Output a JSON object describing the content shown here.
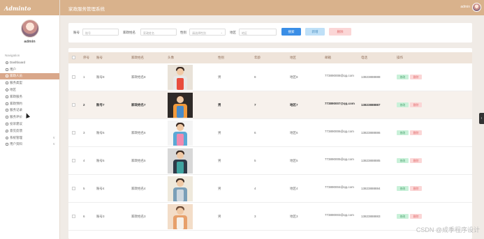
{
  "app": {
    "brand": "Adminto",
    "title": "家政服务管理系统",
    "user": "admin"
  },
  "sidebar": {
    "username": "admin",
    "section_label": "Navigation",
    "items": [
      {
        "label": "Dashboard",
        "icon": "home-icon"
      },
      {
        "label": "用户",
        "icon": "grid-icon"
      },
      {
        "label": "家政人员",
        "icon": "grid-icon",
        "active": true
      },
      {
        "label": "服务类型",
        "icon": "grid-icon"
      },
      {
        "label": "地区",
        "icon": "tag-icon"
      },
      {
        "label": "家政服务",
        "icon": "grid-icon"
      },
      {
        "label": "家政预约",
        "icon": "grid-icon"
      },
      {
        "label": "服务记录",
        "icon": "grid-icon"
      },
      {
        "label": "服务评价",
        "icon": "grid-icon"
      },
      {
        "label": "投诉建议",
        "icon": "grid-icon"
      },
      {
        "label": "意见反馈",
        "icon": "pin-icon"
      },
      {
        "label": "系统管理",
        "icon": "gear-icon",
        "chevron": "∨"
      },
      {
        "label": "用户资料",
        "icon": "user-icon",
        "chevron": "∨"
      }
    ]
  },
  "search": {
    "account_label": "账号",
    "account_placeholder": "账号",
    "name_label": "家政姓名",
    "name_placeholder": "家政姓名",
    "gender_label": "性别",
    "gender_placeholder": "请选择性别",
    "region_label": "地区",
    "region_placeholder": "地区",
    "search_btn": "搜索",
    "add_btn": "新增",
    "delete_btn": "删除"
  },
  "table": {
    "headers": [
      "序号",
      "账号",
      "家政姓名",
      "头像",
      "性别",
      "年龄",
      "地区",
      "邮箱",
      "电话",
      "操作"
    ],
    "edit_label": "修改",
    "delete_label": "删除",
    "rows": [
      {
        "index": "1",
        "account": "账号8",
        "name": "家政姓名8",
        "gender": "男",
        "age": "8",
        "region": "地区8",
        "email": "773890008@qq.com",
        "phone": "13823888888"
      },
      {
        "index": "2",
        "account": "账号7",
        "name": "家政姓名7",
        "gender": "男",
        "age": "7",
        "region": "地区7",
        "email": "773890007@qq.com",
        "phone": "13823888887"
      },
      {
        "index": "3",
        "account": "账号6",
        "name": "家政姓名6",
        "gender": "男",
        "age": "6",
        "region": "地区6",
        "email": "773890006@qq.com",
        "phone": "13823888886"
      },
      {
        "index": "4",
        "account": "账号5",
        "name": "家政姓名5",
        "gender": "男",
        "age": "5",
        "region": "地区5",
        "email": "773890005@qq.com",
        "phone": "13823888885"
      },
      {
        "index": "5",
        "account": "账号4",
        "name": "家政姓名4",
        "gender": "男",
        "age": "4",
        "region": "地区4",
        "email": "773890004@qq.com",
        "phone": "13823888884"
      },
      {
        "index": "6",
        "account": "账号3",
        "name": "家政姓名3",
        "gender": "男",
        "age": "3",
        "region": "地区3",
        "email": "773890003@qq.com",
        "phone": "13823888883"
      }
    ]
  },
  "watermark": "CSDN @成季程序设计",
  "colors": {
    "header": "#d9b28c",
    "active_menu": "#d9a78a",
    "search_btn": "#3a8ee6",
    "add_btn": "#bfe0f7",
    "delete_btn": "#fbd6d6"
  }
}
